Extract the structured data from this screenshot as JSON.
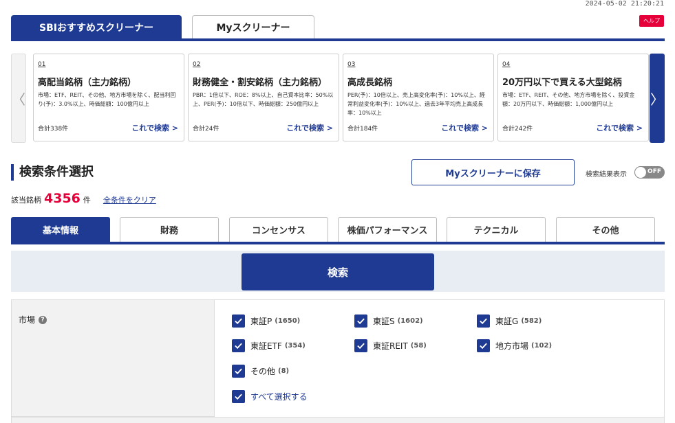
{
  "timestamp": "2024-05-02 21:20:21",
  "help_label": "ヘルプ",
  "top_tabs": [
    {
      "label": "SBIおすすめスクリーナー"
    },
    {
      "label": "Myスクリーナー"
    }
  ],
  "cards": [
    {
      "num": "01",
      "title": "高配当銘柄（主力銘柄）",
      "desc": "市場：ETF、REIT、その他、地方市場を除く、配当利回り(予)：3.0%以上、時価総額：100億円以上",
      "count": "合計338件",
      "link": "これで検索 >"
    },
    {
      "num": "02",
      "title": "財務健全・割安銘柄（主力銘柄）",
      "desc": "PBR：1倍以下、ROE：8%以上、自己資本比率：50%以上、PER(予)：10倍以下、時価総額：250億円以上",
      "count": "合計24件",
      "link": "これで検索 >"
    },
    {
      "num": "03",
      "title": "高成長銘柄",
      "desc": "PER(予)：10倍以上、売上高変化率(予)：10%以上、経常利益変化率(予)：10%以上、過去3年平均売上高成長率：10%以上",
      "count": "合計184件",
      "link": "これで検索 >"
    },
    {
      "num": "04",
      "title": "20万円以下で買える大型銘柄",
      "desc": "市場：ETF、REIT、その他、地方市場を除く、投資金額：20万円以下、時価総額：1,000億円以上",
      "count": "合計242件",
      "link": "これで検索 >"
    }
  ],
  "arrows": {
    "left": "〈",
    "right": "〉"
  },
  "section_title": "検索条件選択",
  "save_button": "Myスクリーナーに保存",
  "toggle": {
    "label": "検索結果表示",
    "state": "OFF"
  },
  "hits": {
    "prefix": "該当銘柄",
    "count": "4356",
    "suffix": "件",
    "clear": "全条件をクリア"
  },
  "category_tabs": [
    {
      "label": "基本情報"
    },
    {
      "label": "財務"
    },
    {
      "label": "コンセンサス"
    },
    {
      "label": "株価パフォーマンス"
    },
    {
      "label": "テクニカル"
    },
    {
      "label": "その他"
    }
  ],
  "search_button": "検索",
  "market": {
    "label": "市場",
    "help_icon": "question-icon",
    "options": [
      {
        "label": "東証P",
        "count": "(1650)",
        "checked": true
      },
      {
        "label": "東証S",
        "count": "(1602)",
        "checked": true
      },
      {
        "label": "東証G",
        "count": "(582)",
        "checked": true
      },
      {
        "label": "東証ETF",
        "count": "(354)",
        "checked": true
      },
      {
        "label": "東証REIT",
        "count": "(58)",
        "checked": true
      },
      {
        "label": "地方市場",
        "count": "(102)",
        "checked": true
      },
      {
        "label": "その他",
        "count": "(8)",
        "checked": true
      }
    ],
    "select_all": "すべて選択する"
  },
  "colors": {
    "navy": "#1f3a93",
    "red": "#e6003a"
  }
}
